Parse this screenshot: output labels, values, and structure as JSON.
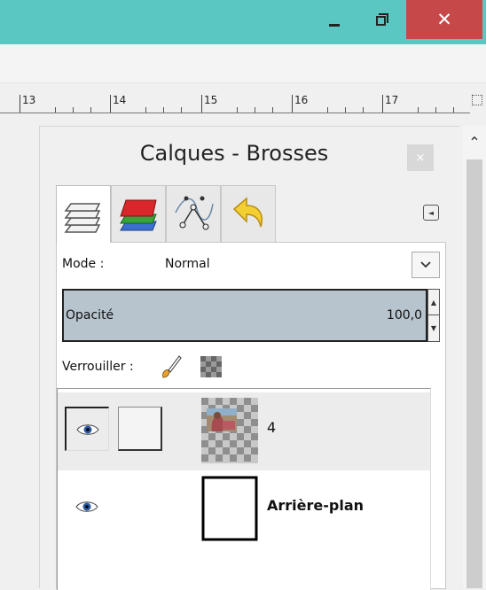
{
  "window": {
    "minimize_glyph": "–",
    "close_glyph": "✕",
    "accent_color": "#5ac7c3",
    "close_color": "#c74848"
  },
  "ruler": {
    "labels": [
      "13",
      "14",
      "15",
      "16",
      "17"
    ]
  },
  "dock": {
    "title": "Calques - Brosses",
    "close_glyph": "×",
    "tabs": [
      {
        "name": "layers",
        "icon": "layers-icon"
      },
      {
        "name": "channels",
        "icon": "channels-icon"
      },
      {
        "name": "paths",
        "icon": "paths-icon"
      },
      {
        "name": "undo-history",
        "icon": "undo-icon"
      }
    ],
    "tab_menu_glyph": "◄"
  },
  "layers_panel": {
    "mode_label": "Mode :",
    "mode_value": "Normal",
    "opacity_label": "Opacité",
    "opacity_value": "100,0",
    "lock_label": "Verrouiller :",
    "layers": [
      {
        "name": "4",
        "visible": true,
        "selected": true,
        "bold": false
      },
      {
        "name": "Arrière-plan",
        "visible": true,
        "selected": false,
        "bold": true
      }
    ]
  }
}
